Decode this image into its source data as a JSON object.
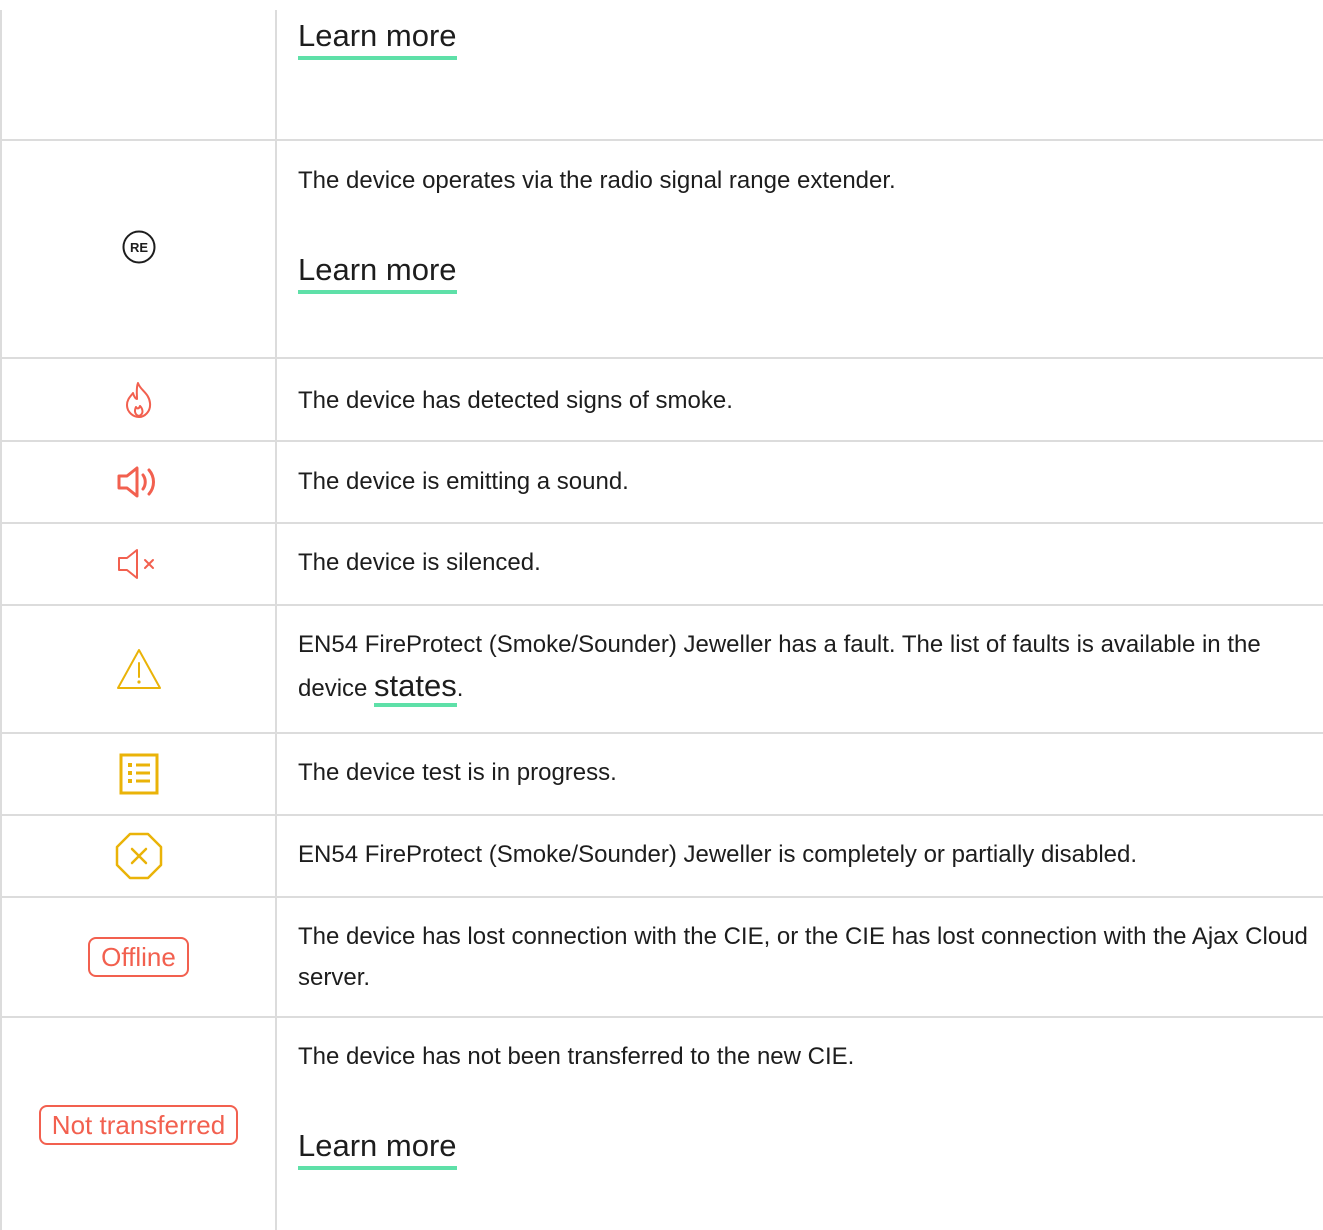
{
  "rows": [
    {
      "learn_more": "Learn more"
    },
    {
      "icon": "re-badge-icon",
      "icon_text": "RE",
      "description": "The device operates via the radio signal range extender.",
      "learn_more": "Learn more"
    },
    {
      "icon": "fire-icon",
      "description": "The device has detected signs of smoke."
    },
    {
      "icon": "speaker-sound-icon",
      "description": "The device is emitting a sound."
    },
    {
      "icon": "speaker-muted-icon",
      "description": "The device is silenced."
    },
    {
      "icon": "warning-triangle-icon",
      "description_before": "EN54 FireProtect (Smoke/Sounder) Jeweller has a fault. The list of faults is available in the device ",
      "link": "states",
      "description_after": "."
    },
    {
      "icon": "test-list-icon",
      "description": "The device test is in progress."
    },
    {
      "icon": "disabled-octagon-icon",
      "description": "EN54 FireProtect (Smoke/Sounder) Jeweller is completely or partially disabled."
    },
    {
      "badge": "Offline",
      "description": "The device has lost connection with the CIE, or the CIE has lost connection with the Ajax Cloud server."
    },
    {
      "badge": "Not transferred",
      "description": "The device has not been transferred to the new CIE.",
      "learn_more": "Learn more"
    }
  ],
  "colors": {
    "red": "#f2604f",
    "yellow": "#eab308",
    "link_underline": "#5ee0a8",
    "border": "#dcdcdc"
  }
}
